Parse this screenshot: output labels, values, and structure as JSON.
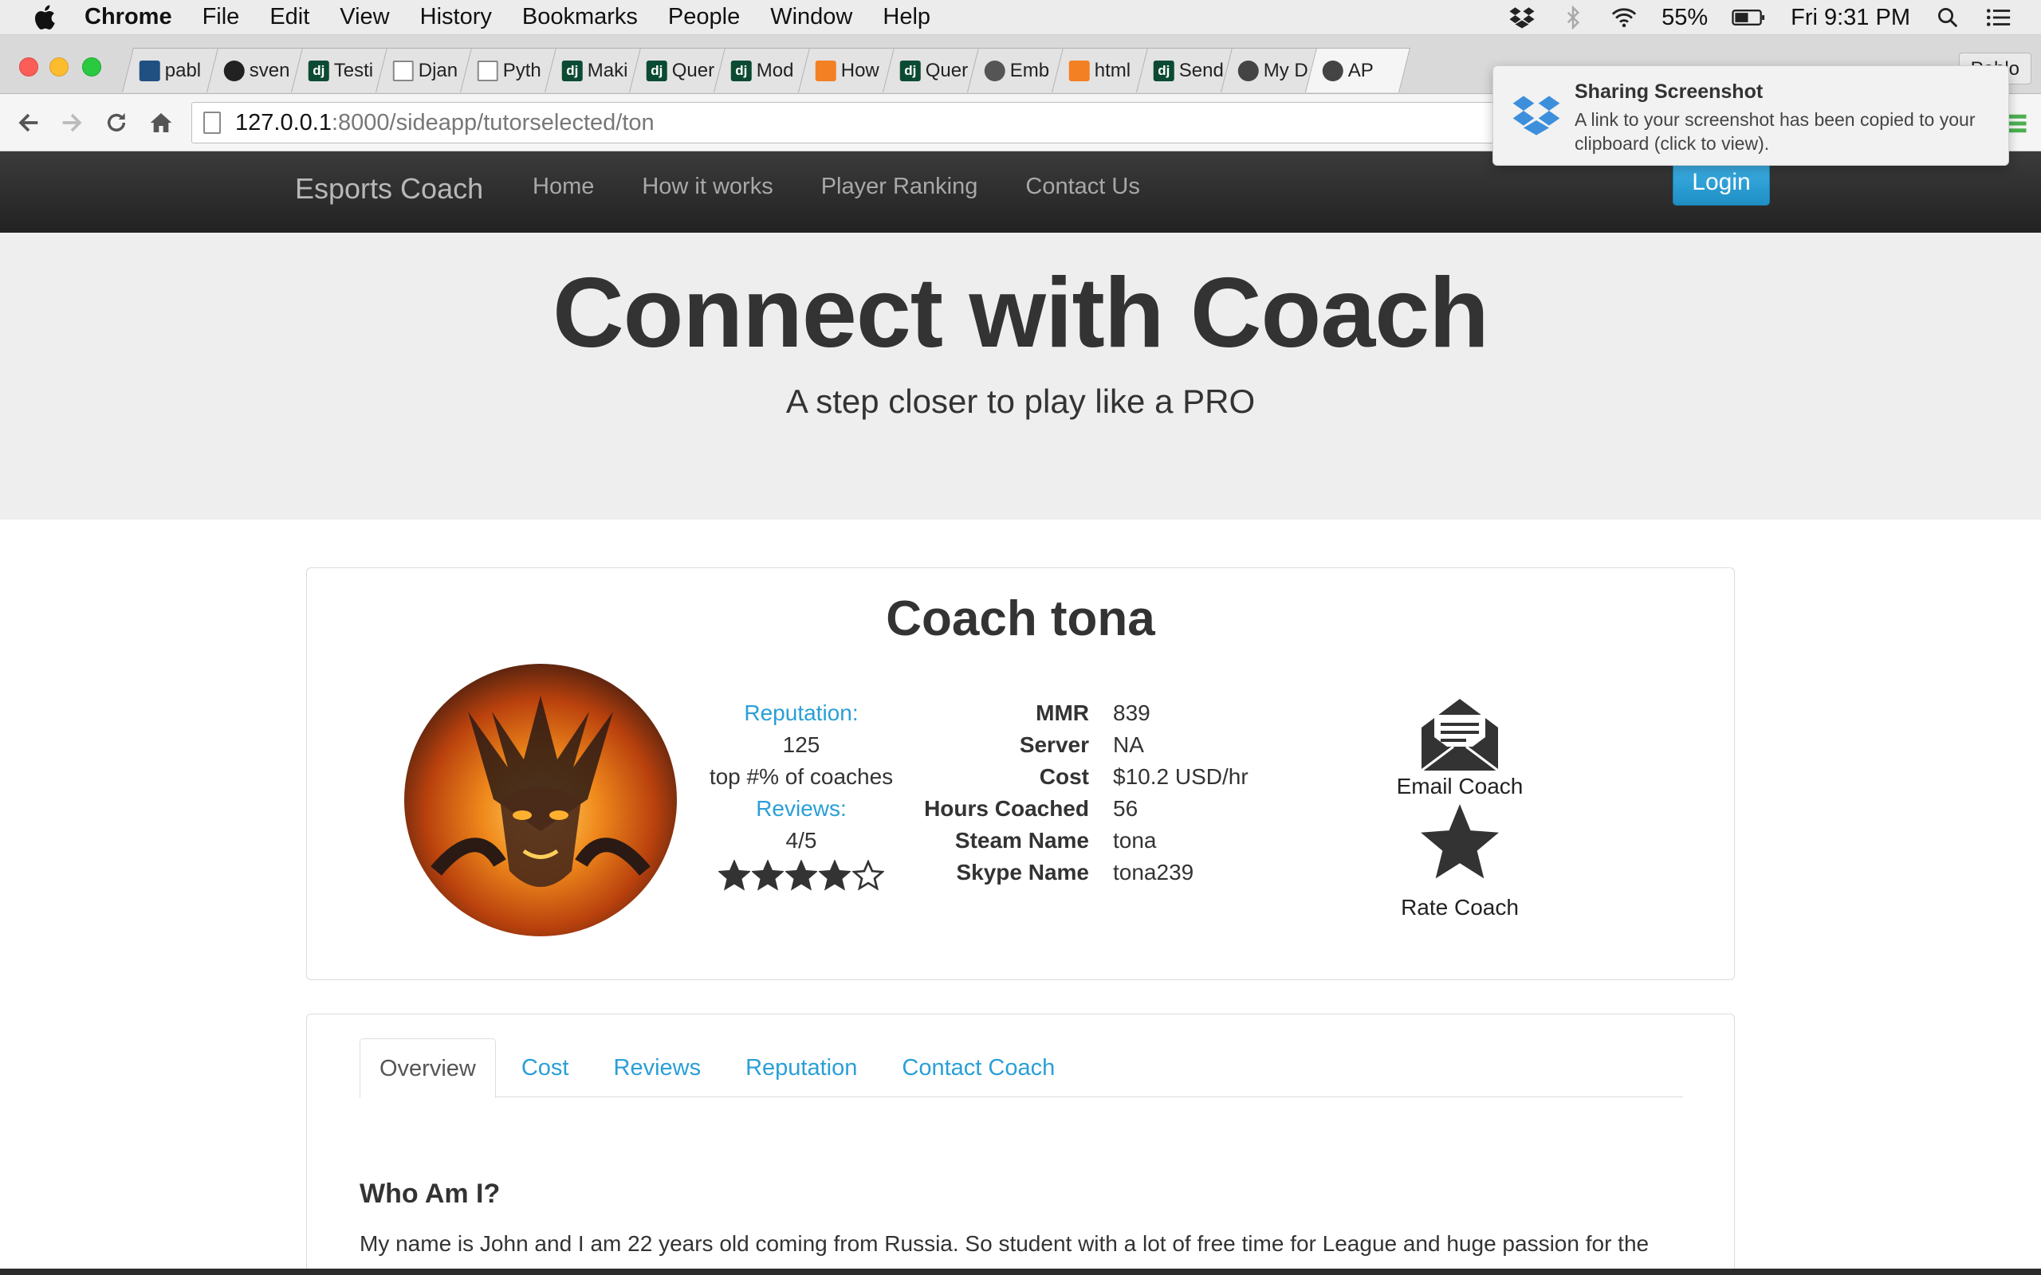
{
  "menubar": {
    "app_name": "Chrome",
    "items": [
      "File",
      "Edit",
      "View",
      "History",
      "Bookmarks",
      "People",
      "Window",
      "Help"
    ],
    "battery": "55%",
    "clock": "Fri 9:31 PM"
  },
  "browser": {
    "tabs": [
      {
        "icon": "bucket",
        "label": "pabl"
      },
      {
        "icon": "github",
        "label": "sven"
      },
      {
        "icon": "dj",
        "label": "Testi"
      },
      {
        "icon": "doc",
        "label": "Djan"
      },
      {
        "icon": "doc",
        "label": "Pyth"
      },
      {
        "icon": "dj",
        "label": "Maki"
      },
      {
        "icon": "dj",
        "label": "Quer"
      },
      {
        "icon": "dj",
        "label": "Mod"
      },
      {
        "icon": "stackoverflow",
        "label": "How"
      },
      {
        "icon": "dj",
        "label": "Quer"
      },
      {
        "icon": "ember",
        "label": "Emb"
      },
      {
        "icon": "stackoverflow",
        "label": "html"
      },
      {
        "icon": "dj",
        "label": "Send"
      },
      {
        "icon": "heart",
        "label": "My D"
      },
      {
        "icon": "heart",
        "label": "AP"
      }
    ],
    "profile_label": "Pablo",
    "url_host": "127.0.0.1",
    "url_path": ":8000/sideapp/tutorselected/ton"
  },
  "notification": {
    "title": "Sharing Screenshot",
    "body": "A link to your screenshot has been copied to your clipboard (click to view)."
  },
  "site": {
    "brand": "Esports Coach",
    "nav": [
      "Home",
      "How it works",
      "Player Ranking",
      "Contact Us"
    ],
    "login": "Login",
    "hero_title": "Connect with Coach",
    "hero_subtitle": "A step closer to play like a PRO"
  },
  "coach": {
    "heading": "Coach tona",
    "reputation_label": "Reputation:",
    "reputation_value": "125",
    "rank_text": "top #% of coaches",
    "reviews_label": "Reviews:",
    "reviews_value": "4/5",
    "rating_stars": 4,
    "rating_max": 5,
    "stats": [
      {
        "label": "MMR",
        "value": "839"
      },
      {
        "label": "Server",
        "value": "NA"
      },
      {
        "label": "Cost",
        "value": "$10.2 USD/hr"
      },
      {
        "label": "Hours Coached",
        "value": "56"
      },
      {
        "label": "Steam Name",
        "value": "tona"
      },
      {
        "label": "Skype Name",
        "value": "tona239"
      }
    ],
    "email_action": "Email Coach",
    "rate_action": "Rate Coach"
  },
  "details": {
    "tabs": [
      "Overview",
      "Cost",
      "Reviews",
      "Reputation",
      "Contact Coach"
    ],
    "active_tab": "Overview",
    "section_title": "Who Am I?",
    "bio": "My name is John and I am 22 years old coming from Russia. So student with a lot of free time for League and huge passion for the"
  },
  "colors": {
    "accent": "#2a9fd6",
    "navbar": "#2a2a2a",
    "jumbotron": "#eeeeee"
  }
}
